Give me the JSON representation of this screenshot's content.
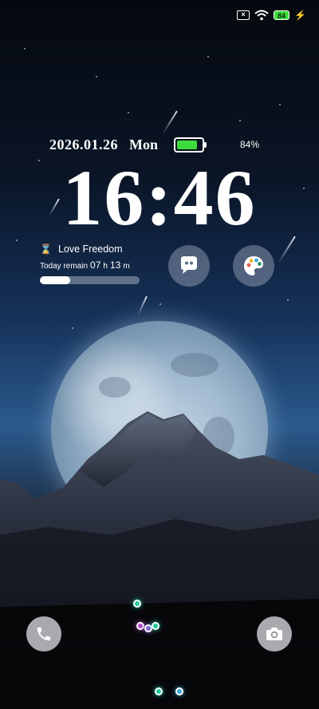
{
  "status_bar": {
    "sim_icon": "sim-missing-icon",
    "wifi_icon": "wifi-icon",
    "battery_level": "84",
    "charging_icon": "bolt-icon"
  },
  "lockscreen": {
    "date": "2026.01.26",
    "weekday": "Mon",
    "battery_percent": "84%",
    "battery_fraction": 0.84,
    "time": "16:46"
  },
  "widget": {
    "icon": "hourglass-icon",
    "title": "Love Freedom",
    "remain_label": "Today remain",
    "hours": "07",
    "hours_unit": "h",
    "minutes": "13",
    "minutes_unit": "m",
    "progress_fraction": 0.3
  },
  "shortcuts": {
    "chat_icon": "chat-bubble-icon",
    "theme_icon": "palette-icon"
  },
  "bottom": {
    "left_icon": "phone-icon",
    "right_icon": "camera-icon"
  },
  "colors": {
    "battery_green": "#3ddc3d",
    "dot_teal": "#1ec99b",
    "dot_magenta": "#b44ac8",
    "dot_lightblue": "#3aa9d6"
  }
}
